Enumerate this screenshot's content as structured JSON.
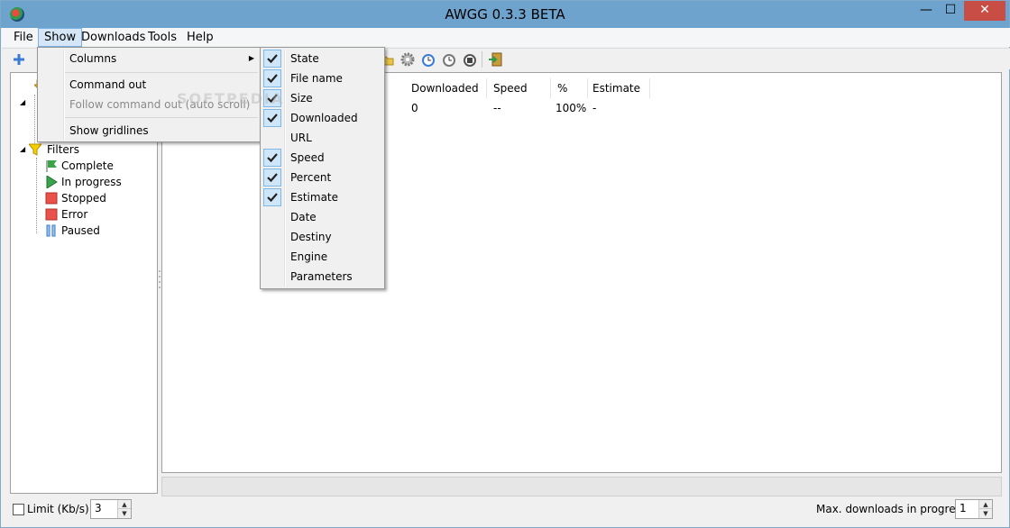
{
  "window": {
    "title": "AWGG 0.3.3 BETA",
    "controls": {
      "minimize": "—",
      "maximize": "☐",
      "close": "✕"
    }
  },
  "menubar": {
    "items": [
      {
        "label": "File",
        "active": false
      },
      {
        "label": "Show",
        "active": true
      },
      {
        "label": "Downloads",
        "active": false
      },
      {
        "label": "Tools",
        "active": false
      },
      {
        "label": "Help",
        "active": false
      }
    ]
  },
  "toolbar": {
    "icons": [
      "add-icon",
      "folder-icon",
      "gear-icon",
      "scheduler-icon",
      "clock-icon",
      "clock-stop-icon",
      "exit-icon"
    ]
  },
  "tree": {
    "filters_label": "Filters",
    "items": [
      {
        "label": "Complete",
        "icon": "green-flag-icon"
      },
      {
        "label": "In progress",
        "icon": "play-icon"
      },
      {
        "label": "Stopped",
        "icon": "stop-icon"
      },
      {
        "label": "Error",
        "icon": "error-icon"
      },
      {
        "label": "Paused",
        "icon": "pause-icon"
      }
    ]
  },
  "list": {
    "headers": {
      "downloaded": "Downloaded",
      "speed": "Speed",
      "percent": "%",
      "estimate": "Estimate"
    },
    "row": {
      "downloaded": "0",
      "speed": "--",
      "percent": "100%",
      "estimate": "-"
    }
  },
  "show_menu": {
    "columns": "Columns",
    "command_out": "Command out",
    "follow_command_out": "Follow command out (auto scroll)",
    "show_gridlines": "Show gridlines"
  },
  "columns_menu": {
    "items": [
      {
        "label": "State",
        "checked": true
      },
      {
        "label": "File name",
        "checked": true
      },
      {
        "label": "Size",
        "checked": true
      },
      {
        "label": "Downloaded",
        "checked": true
      },
      {
        "label": "URL",
        "checked": false
      },
      {
        "label": "Speed",
        "checked": true
      },
      {
        "label": "Percent",
        "checked": true
      },
      {
        "label": "Estimate",
        "checked": true
      },
      {
        "label": "Date",
        "checked": false
      },
      {
        "label": "Destiny",
        "checked": false
      },
      {
        "label": "Engine",
        "checked": false
      },
      {
        "label": "Parameters",
        "checked": false
      }
    ]
  },
  "statusbar": {
    "limit_label": "Limit (Kb/s):",
    "limit_checked": false,
    "limit_value": "3",
    "max_label": "Max. downloads in progress:",
    "max_value": "1"
  },
  "colors": {
    "titlebar": "#6ea3cd",
    "close_button": "#c84e45",
    "check_highlight": "#cfe6f8"
  }
}
